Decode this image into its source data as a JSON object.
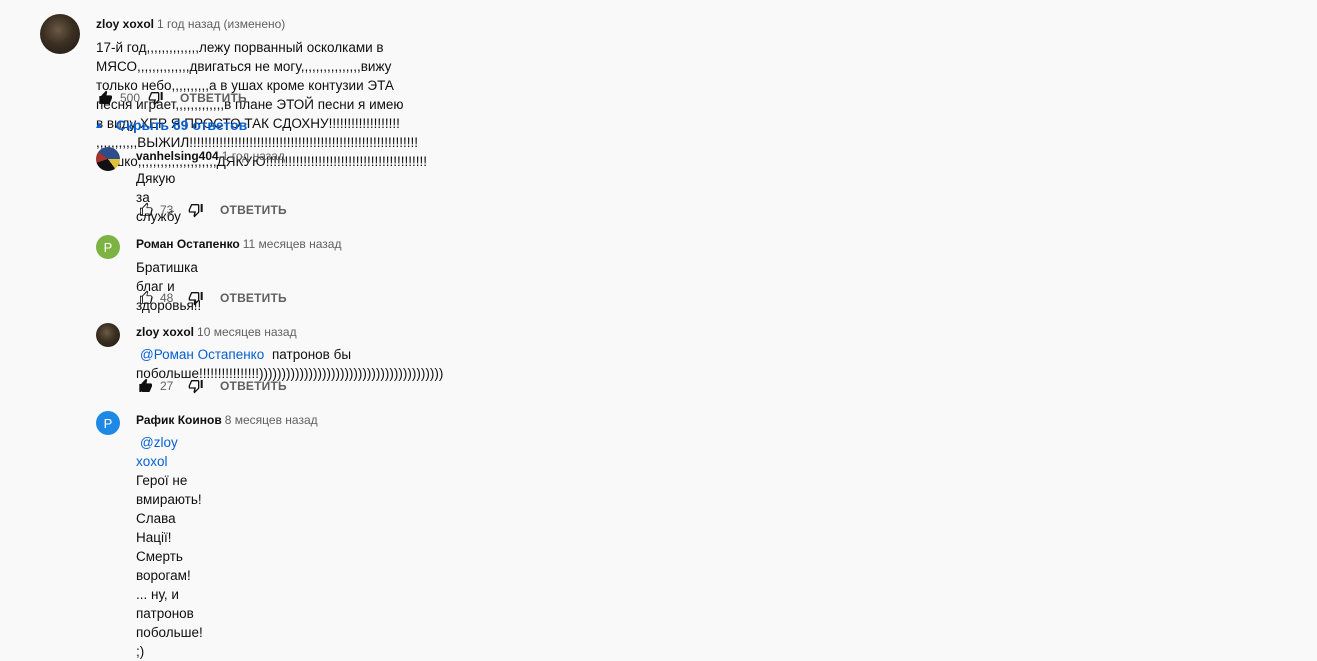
{
  "top": {
    "author": "zloy xoxol",
    "time": "1 год назад (изменено)",
    "text_line1": "17-й год,,,,,,,,,,,,,,лежу порванный осколками в МЯСО,,,,,,,,,,,,,,двигаться не могу,,,,,,,,,,,,,,,,вижу только небо,,,,,,,,,,а в ушах кроме контузии ЭТА песня играет,,,,,,,,,,,,,в плане ЭТОЙ песни я имею",
    "text_line2": "в виду ХЕР Я ПРОСТО ТАК СДОХНУ!!!!!!!!!!!!!!!!!!! ,,,,,,,,,,,ВЫЖИЛ!!!!!!!!!!!!!!!!!!!!!!!!!!!!!!!!!!!!!!!!!!!!!!!!!!!!!!!!!!!!!Сашко,,,,,,,,,,,,,,,,,,,,,ДЯКУЮ!!!!!!!!!!!!!!!!!!!!!!!!!!!!!!!!!!!!!!!!!!!",
    "likes": "500",
    "reply_label": "ОТВЕТИТЬ"
  },
  "replies_toggle": {
    "caret": "▲",
    "label": "Скрыть 69 ответов"
  },
  "replies": [
    {
      "author": "vanhelsing404",
      "time": "1 год назад",
      "text": "Дякую за службу",
      "likes": "73",
      "reply_label": "ОТВЕТИТЬ"
    },
    {
      "author": "Роман Остапенко",
      "time": "11 месяцев назад",
      "avatar_letter": "Р",
      "avatar_color": "#7cb342",
      "text": "Братишка благ и здоровья!!",
      "likes": "48",
      "reply_label": "ОТВЕТИТЬ"
    },
    {
      "author": "zloy xoxol",
      "time": "10 месяцев назад",
      "mention": "@Роман Остапенко",
      "text": " патронов бы побольше!!!!!!!!!!!!!!!!)))))))))))))))))))))))))))))))))))))))))",
      "likes": "27",
      "reply_label": "ОТВЕТИТЬ"
    },
    {
      "author": "Рафик Коинов",
      "time": "8 месяцев назад",
      "avatar_letter": "Р",
      "avatar_color": "#1e88e5",
      "mention": "@zloy xoxol",
      "text_line1": " Герої не вмирають!",
      "text_line2": "Слава Нації! Смерть ворогам!",
      "text_line3": "... ну, и патронов побольше! ;)"
    }
  ]
}
